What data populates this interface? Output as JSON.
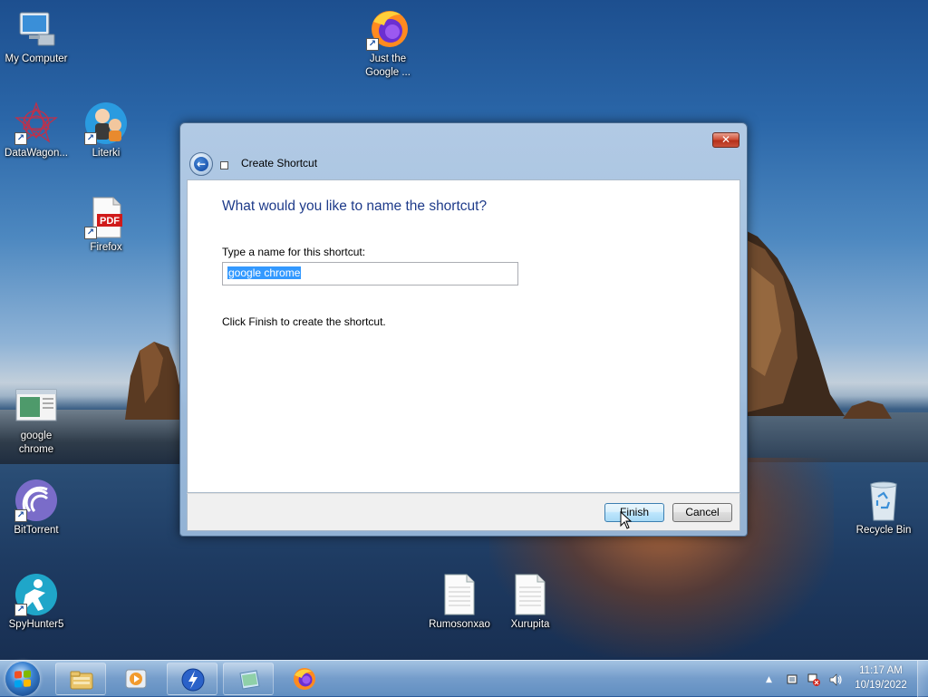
{
  "desktop": {
    "icons": [
      {
        "label": "My Computer"
      },
      {
        "label": "Just the Google ..."
      },
      {
        "label": "DataWagon..."
      },
      {
        "label": "Literki"
      },
      {
        "label": "Firefox"
      },
      {
        "label": "google chrome"
      },
      {
        "label": "BitTorrent"
      },
      {
        "label": "Recycle Bin"
      },
      {
        "label": "SpyHunter5"
      },
      {
        "label": "Rumosonxao"
      },
      {
        "label": "Xurupita"
      }
    ],
    "pdf_badge": "PDF"
  },
  "dialog": {
    "title": "Create Shortcut",
    "close_glyph": "✕",
    "back_glyph": "←",
    "heading": "What would you like to name the shortcut?",
    "name_label": "Type a name for this shortcut:",
    "name_value": "google chrome",
    "instruction": "Click Finish to create the shortcut.",
    "finish_label": "Finish",
    "cancel_label": "Cancel"
  },
  "taskbar": {
    "pinned": [
      "windows-explorer",
      "media-player",
      "bittorrent-lightning",
      "notepad-editor",
      "firefox"
    ],
    "tray_chevron": "▲",
    "time": "11:17 AM",
    "date": "10/19/2022"
  },
  "colors": {
    "heading_blue": "#1e3b8a",
    "selection": "#3399ff",
    "close_red": "#c9503a"
  }
}
